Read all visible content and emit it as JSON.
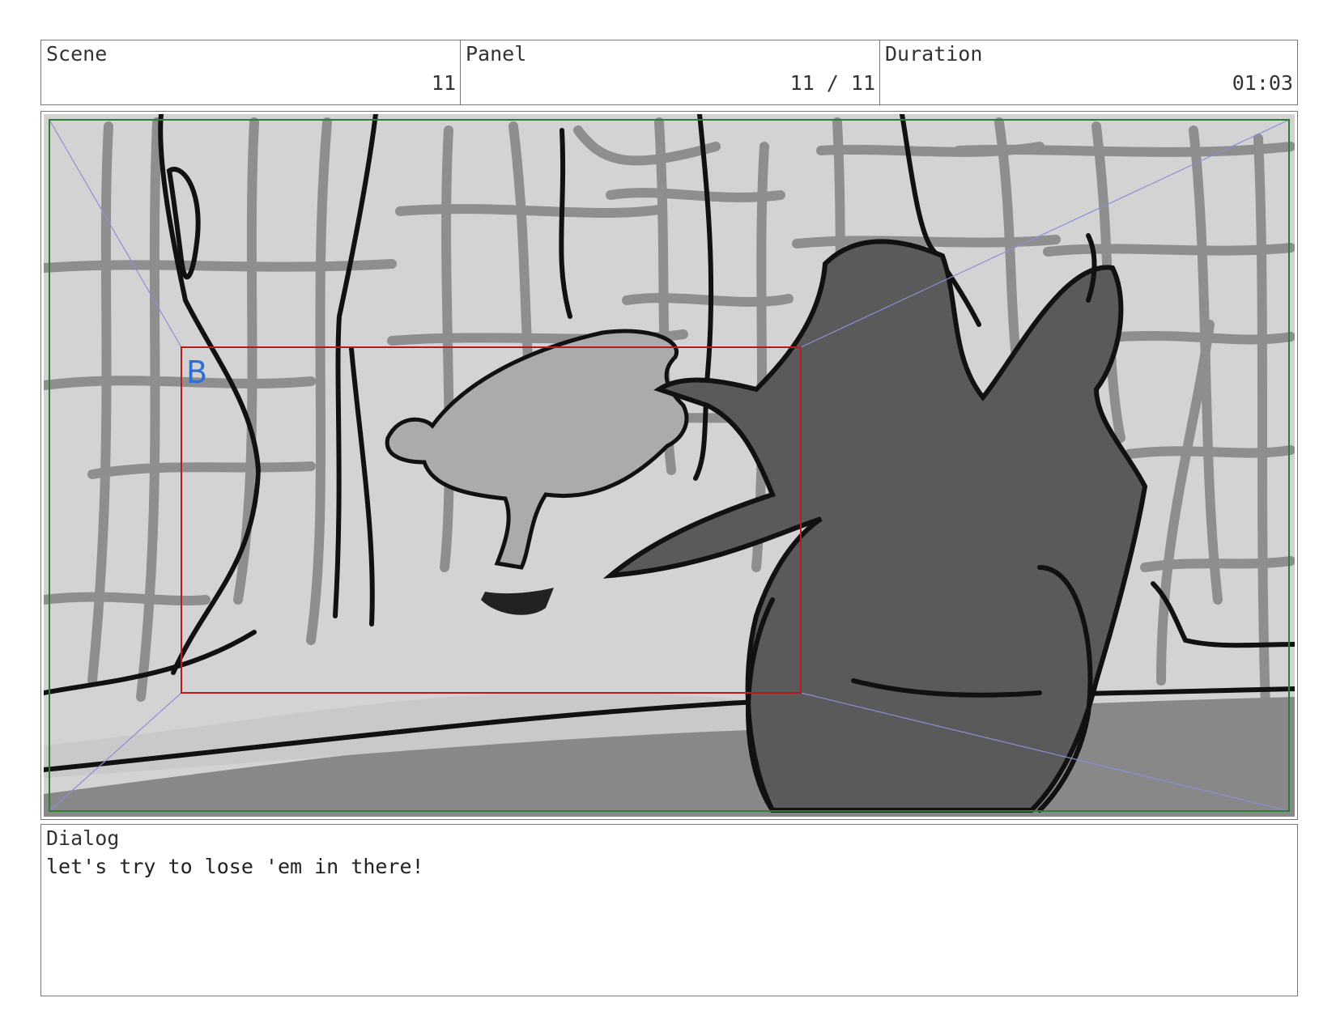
{
  "header": {
    "scene": {
      "label": "Scene",
      "value": "11"
    },
    "panel": {
      "label": "Panel",
      "value": "11 / 11"
    },
    "duration": {
      "label": "Duration",
      "value": "01:03"
    }
  },
  "frame": {
    "camera_label": "B"
  },
  "dialog": {
    "label": "Dialog",
    "text": "let's try to lose 'em in there!"
  },
  "colors": {
    "safe_frame": "#2e7d32",
    "camera_frame": "#b71c1c",
    "camera_label": "#2f6fd1",
    "guide_lines": "#8a8fd8"
  }
}
